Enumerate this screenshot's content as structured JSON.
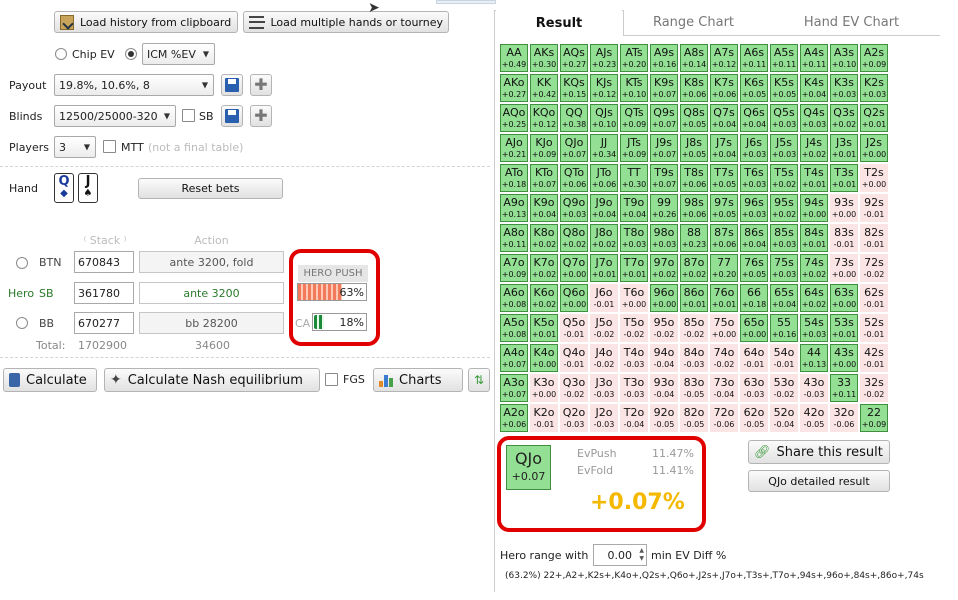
{
  "toolbar": {
    "load_clipboard": "Load history from clipboard",
    "load_multiple": "Load multiple hands or tourney"
  },
  "ev_mode": {
    "chip_ev": "Chip EV",
    "icm": "ICM %EV"
  },
  "payout": {
    "label": "Payout",
    "value": "19.8%, 10.6%, 8"
  },
  "blinds": {
    "label": "Blinds",
    "value": "12500/25000-320",
    "sb": "SB"
  },
  "players": {
    "label": "Players",
    "value": "3",
    "mtt": "MTT",
    "mtt_note": "(not a final table)"
  },
  "hand": {
    "label": "Hand",
    "card1": "Q",
    "card2": "J",
    "reset": "Reset bets"
  },
  "table": {
    "stack_header": "Stack",
    "action_header": "Action",
    "rows": [
      {
        "pos": "BTN",
        "stack": "670843",
        "action": "ante 3200, fold"
      },
      {
        "hero": "Hero",
        "pos": "SB",
        "stack": "361780",
        "action": "ante 3200"
      },
      {
        "pos": "BB",
        "stack": "670277",
        "action": "bb 28200"
      }
    ],
    "total_label": "Total:",
    "total_stack": "1702900",
    "total_pot": "34600"
  },
  "push_panel": {
    "title": "HERO PUSH",
    "push_pct": "63%",
    "call_label": "CA",
    "call_pct": "18%",
    "push_fill": 0.63,
    "call_fill": 0.18
  },
  "bottom": {
    "calculate": "Calculate",
    "nash": "Calculate Nash equilibrium",
    "fgs": "FGS",
    "charts": "Charts"
  },
  "tabs": [
    "Result",
    "Range Chart",
    "Hand EV Chart"
  ],
  "grid": [
    [
      [
        "AA",
        "+0.49",
        "p"
      ],
      [
        "AKs",
        "+0.30",
        "p"
      ],
      [
        "AQs",
        "+0.27",
        "p"
      ],
      [
        "AJs",
        "+0.23",
        "p"
      ],
      [
        "ATs",
        "+0.20",
        "p"
      ],
      [
        "A9s",
        "+0.16",
        "p"
      ],
      [
        "A8s",
        "+0.14",
        "p"
      ],
      [
        "A7s",
        "+0.12",
        "p"
      ],
      [
        "A6s",
        "+0.11",
        "p"
      ],
      [
        "A5s",
        "+0.11",
        "p"
      ],
      [
        "A4s",
        "+0.11",
        "p"
      ],
      [
        "A3s",
        "+0.10",
        "p"
      ],
      [
        "A2s",
        "+0.09",
        "p"
      ]
    ],
    [
      [
        "AKo",
        "+0.27",
        "p"
      ],
      [
        "KK",
        "+0.42",
        "p"
      ],
      [
        "KQs",
        "+0.15",
        "p"
      ],
      [
        "KJs",
        "+0.12",
        "p"
      ],
      [
        "KTs",
        "+0.10",
        "p"
      ],
      [
        "K9s",
        "+0.07",
        "p"
      ],
      [
        "K8s",
        "+0.06",
        "p"
      ],
      [
        "K7s",
        "+0.06",
        "p"
      ],
      [
        "K6s",
        "+0.05",
        "p"
      ],
      [
        "K5s",
        "+0.05",
        "p"
      ],
      [
        "K4s",
        "+0.04",
        "p"
      ],
      [
        "K3s",
        "+0.03",
        "p"
      ],
      [
        "K2s",
        "+0.03",
        "p"
      ]
    ],
    [
      [
        "AQo",
        "+0.25",
        "p"
      ],
      [
        "KQo",
        "+0.12",
        "p"
      ],
      [
        "QQ",
        "+0.38",
        "p"
      ],
      [
        "QJs",
        "+0.10",
        "p"
      ],
      [
        "QTs",
        "+0.09",
        "p"
      ],
      [
        "Q9s",
        "+0.07",
        "p"
      ],
      [
        "Q8s",
        "+0.05",
        "p"
      ],
      [
        "Q7s",
        "+0.04",
        "p"
      ],
      [
        "Q6s",
        "+0.04",
        "p"
      ],
      [
        "Q5s",
        "+0.03",
        "p"
      ],
      [
        "Q4s",
        "+0.03",
        "p"
      ],
      [
        "Q3s",
        "+0.02",
        "p"
      ],
      [
        "Q2s",
        "+0.01",
        "p"
      ]
    ],
    [
      [
        "AJo",
        "+0.21",
        "p"
      ],
      [
        "KJo",
        "+0.09",
        "p"
      ],
      [
        "QJo",
        "+0.07",
        "p"
      ],
      [
        "JJ",
        "+0.34",
        "p"
      ],
      [
        "JTs",
        "+0.09",
        "p"
      ],
      [
        "J9s",
        "+0.07",
        "p"
      ],
      [
        "J8s",
        "+0.05",
        "p"
      ],
      [
        "J7s",
        "+0.04",
        "p"
      ],
      [
        "J6s",
        "+0.03",
        "p"
      ],
      [
        "J5s",
        "+0.03",
        "p"
      ],
      [
        "J4s",
        "+0.02",
        "p"
      ],
      [
        "J3s",
        "+0.01",
        "p"
      ],
      [
        "J2s",
        "+0.00",
        "p"
      ]
    ],
    [
      [
        "ATo",
        "+0.18",
        "p"
      ],
      [
        "KTo",
        "+0.07",
        "p"
      ],
      [
        "QTo",
        "+0.06",
        "p"
      ],
      [
        "JTo",
        "+0.06",
        "p"
      ],
      [
        "TT",
        "+0.30",
        "p"
      ],
      [
        "T9s",
        "+0.07",
        "p"
      ],
      [
        "T8s",
        "+0.06",
        "p"
      ],
      [
        "T7s",
        "+0.05",
        "p"
      ],
      [
        "T6s",
        "+0.03",
        "p"
      ],
      [
        "T5s",
        "+0.02",
        "p"
      ],
      [
        "T4s",
        "+0.01",
        "p"
      ],
      [
        "T3s",
        "+0.01",
        "p"
      ],
      [
        "T2s",
        "+0.00",
        "f"
      ]
    ],
    [
      [
        "A9o",
        "+0.13",
        "p"
      ],
      [
        "K9o",
        "+0.04",
        "p"
      ],
      [
        "Q9o",
        "+0.03",
        "p"
      ],
      [
        "J9o",
        "+0.04",
        "p"
      ],
      [
        "T9o",
        "+0.04",
        "p"
      ],
      [
        "99",
        "+0.26",
        "p"
      ],
      [
        "98s",
        "+0.06",
        "p"
      ],
      [
        "97s",
        "+0.05",
        "p"
      ],
      [
        "96s",
        "+0.03",
        "p"
      ],
      [
        "95s",
        "+0.02",
        "p"
      ],
      [
        "94s",
        "+0.00",
        "p"
      ],
      [
        "93s",
        "+0.00",
        "f"
      ],
      [
        "92s",
        "-0.01",
        "f"
      ]
    ],
    [
      [
        "A8o",
        "+0.11",
        "p"
      ],
      [
        "K8o",
        "+0.02",
        "p"
      ],
      [
        "Q8o",
        "+0.02",
        "p"
      ],
      [
        "J8o",
        "+0.02",
        "p"
      ],
      [
        "T8o",
        "+0.03",
        "p"
      ],
      [
        "98o",
        "+0.03",
        "p"
      ],
      [
        "88",
        "+0.23",
        "p"
      ],
      [
        "87s",
        "+0.06",
        "p"
      ],
      [
        "86s",
        "+0.04",
        "p"
      ],
      [
        "85s",
        "+0.03",
        "p"
      ],
      [
        "84s",
        "+0.01",
        "p"
      ],
      [
        "83s",
        "-0.01",
        "f"
      ],
      [
        "82s",
        "-0.01",
        "f"
      ]
    ],
    [
      [
        "A7o",
        "+0.09",
        "p"
      ],
      [
        "K7o",
        "+0.02",
        "p"
      ],
      [
        "Q7o",
        "+0.00",
        "p"
      ],
      [
        "J7o",
        "+0.01",
        "p"
      ],
      [
        "T7o",
        "+0.01",
        "p"
      ],
      [
        "97o",
        "+0.02",
        "p"
      ],
      [
        "87o",
        "+0.02",
        "p"
      ],
      [
        "77",
        "+0.20",
        "p"
      ],
      [
        "76s",
        "+0.05",
        "p"
      ],
      [
        "75s",
        "+0.03",
        "p"
      ],
      [
        "74s",
        "+0.02",
        "p"
      ],
      [
        "73s",
        "+0.00",
        "f"
      ],
      [
        "72s",
        "-0.02",
        "f"
      ]
    ],
    [
      [
        "A6o",
        "+0.08",
        "p"
      ],
      [
        "K6o",
        "+0.02",
        "p"
      ],
      [
        "Q6o",
        "+0.00",
        "p"
      ],
      [
        "J6o",
        "-0.01",
        "f"
      ],
      [
        "T6o",
        "+0.00",
        "f"
      ],
      [
        "96o",
        "+0.00",
        "p"
      ],
      [
        "86o",
        "+0.01",
        "p"
      ],
      [
        "76o",
        "+0.01",
        "p"
      ],
      [
        "66",
        "+0.18",
        "p"
      ],
      [
        "65s",
        "+0.04",
        "p"
      ],
      [
        "64s",
        "+0.02",
        "p"
      ],
      [
        "63s",
        "+0.00",
        "p"
      ],
      [
        "62s",
        "-0.01",
        "f"
      ]
    ],
    [
      [
        "A5o",
        "+0.08",
        "p"
      ],
      [
        "K5o",
        "+0.01",
        "p"
      ],
      [
        "Q5o",
        "-0.01",
        "f"
      ],
      [
        "J5o",
        "-0.02",
        "f"
      ],
      [
        "T5o",
        "-0.02",
        "f"
      ],
      [
        "95o",
        "-0.02",
        "f"
      ],
      [
        "85o",
        "-0.02",
        "f"
      ],
      [
        "75o",
        "+0.00",
        "f"
      ],
      [
        "65o",
        "+0.00",
        "p"
      ],
      [
        "55",
        "+0.16",
        "p"
      ],
      [
        "54s",
        "+0.03",
        "p"
      ],
      [
        "53s",
        "+0.01",
        "p"
      ],
      [
        "52s",
        "-0.01",
        "f"
      ]
    ],
    [
      [
        "A4o",
        "+0.07",
        "p"
      ],
      [
        "K4o",
        "+0.00",
        "p"
      ],
      [
        "Q4o",
        "-0.01",
        "f"
      ],
      [
        "J4o",
        "-0.02",
        "f"
      ],
      [
        "T4o",
        "-0.03",
        "f"
      ],
      [
        "94o",
        "-0.04",
        "f"
      ],
      [
        "84o",
        "-0.03",
        "f"
      ],
      [
        "74o",
        "-0.02",
        "f"
      ],
      [
        "64o",
        "-0.01",
        "f"
      ],
      [
        "54o",
        "-0.01",
        "f"
      ],
      [
        "44",
        "+0.13",
        "p"
      ],
      [
        "43s",
        "+0.00",
        "p"
      ],
      [
        "42s",
        "-0.01",
        "f"
      ]
    ],
    [
      [
        "A3o",
        "+0.07",
        "p"
      ],
      [
        "K3o",
        "+0.00",
        "f"
      ],
      [
        "Q3o",
        "-0.02",
        "f"
      ],
      [
        "J3o",
        "-0.03",
        "f"
      ],
      [
        "T3o",
        "-0.03",
        "f"
      ],
      [
        "93o",
        "-0.04",
        "f"
      ],
      [
        "83o",
        "-0.05",
        "f"
      ],
      [
        "73o",
        "-0.04",
        "f"
      ],
      [
        "63o",
        "-0.03",
        "f"
      ],
      [
        "53o",
        "-0.02",
        "f"
      ],
      [
        "43o",
        "-0.03",
        "f"
      ],
      [
        "33",
        "+0.11",
        "p"
      ],
      [
        "32s",
        "-0.02",
        "f"
      ]
    ],
    [
      [
        "A2o",
        "+0.06",
        "p"
      ],
      [
        "K2o",
        "-0.01",
        "f"
      ],
      [
        "Q2o",
        "-0.03",
        "f"
      ],
      [
        "J2o",
        "-0.03",
        "f"
      ],
      [
        "T2o",
        "-0.04",
        "f"
      ],
      [
        "92o",
        "-0.05",
        "f"
      ],
      [
        "82o",
        "-0.05",
        "f"
      ],
      [
        "72o",
        "-0.06",
        "f"
      ],
      [
        "62o",
        "-0.05",
        "f"
      ],
      [
        "52o",
        "-0.04",
        "f"
      ],
      [
        "42o",
        "-0.05",
        "f"
      ],
      [
        "32o",
        "-0.06",
        "f"
      ],
      [
        "22",
        "+0.09",
        "p"
      ]
    ]
  ],
  "detail": {
    "hand": "QJo",
    "ev": "+0.07",
    "push_label": "EvPush",
    "push_val": "11.47%",
    "fold_label": "EvFold",
    "fold_val": "11.41%",
    "diff": "+0.07%",
    "share": "Share this result",
    "detailed": "QJo detailed result"
  },
  "range": {
    "label": "Hero range with",
    "min_value": "0.00",
    "suffix": "min EV Diff %",
    "text": "(63.2%) 22+,A2+,K2s+,K4o+,Q2s+,Q6o+,J2s+,J7o+,T3s+,T7o+,94s+,96o+,84s+,86o+,74s"
  },
  "colors": {
    "push": "#93df93",
    "fold": "#fbe4e4",
    "diff": "#f5b800",
    "highlight": "#e00000"
  }
}
